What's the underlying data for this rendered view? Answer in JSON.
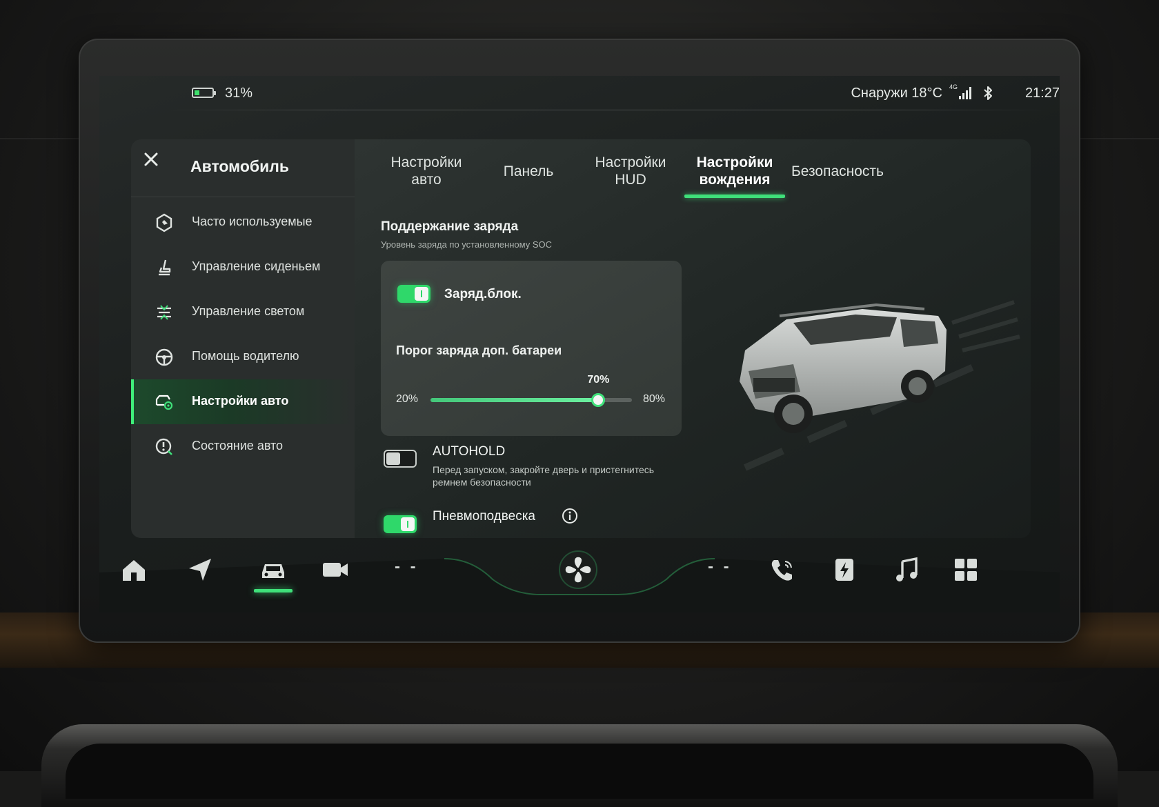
{
  "status": {
    "battery_percent": "31%",
    "battery_level": 0.31,
    "outside_temp": "Снаружи 18°C",
    "network": "4G",
    "time": "21:27"
  },
  "sidebar": {
    "title": "Автомобиль",
    "items": [
      {
        "label": "Часто используемые",
        "icon": "frequent-icon"
      },
      {
        "label": "Управление сиденьем",
        "icon": "seat-icon"
      },
      {
        "label": "Управление светом",
        "icon": "light-icon"
      },
      {
        "label": "Помощь водителю",
        "icon": "steering-wheel-icon"
      },
      {
        "label": "Настройки авто",
        "icon": "car-settings-icon",
        "active": true
      },
      {
        "label": "Состояние авто",
        "icon": "car-status-icon"
      }
    ]
  },
  "tabs": [
    {
      "label": "Настройки\nавто"
    },
    {
      "label": "Панель"
    },
    {
      "label": "Настройки\nHUD"
    },
    {
      "label": "Настройки\nвождения",
      "active": true
    },
    {
      "label": "Безопасность"
    }
  ],
  "charge_section": {
    "title": "Поддержание заряда",
    "subtitle": "Уровень заряда по установленному SOC",
    "lock_label": "Заряд.блок.",
    "lock_on": true,
    "threshold_label": "Порог заряда доп. батареи",
    "slider_min": "20%",
    "slider_max": "80%",
    "slider_value_label": "70%",
    "slider_value": 70,
    "slider_range": [
      20,
      80
    ]
  },
  "autohold": {
    "title": "AUTOHOLD",
    "description": "Перед запуском, закройте дверь и пристегнитесь ремнем безопасности",
    "on": false
  },
  "pneumo": {
    "title": "Пневмоподвеска",
    "on": true
  },
  "dock": {
    "left_temp": "- -",
    "right_temp": "- -",
    "icons": [
      "home-icon",
      "navigation-icon",
      "car-icon",
      "camera-icon",
      "fan-icon",
      "phone-icon",
      "charging-icon",
      "music-icon",
      "apps-icon"
    ],
    "active": "car-icon"
  },
  "colors": {
    "accent": "#3fe07a",
    "panel": "#2a2e2d",
    "background": "#1b1f1e"
  }
}
